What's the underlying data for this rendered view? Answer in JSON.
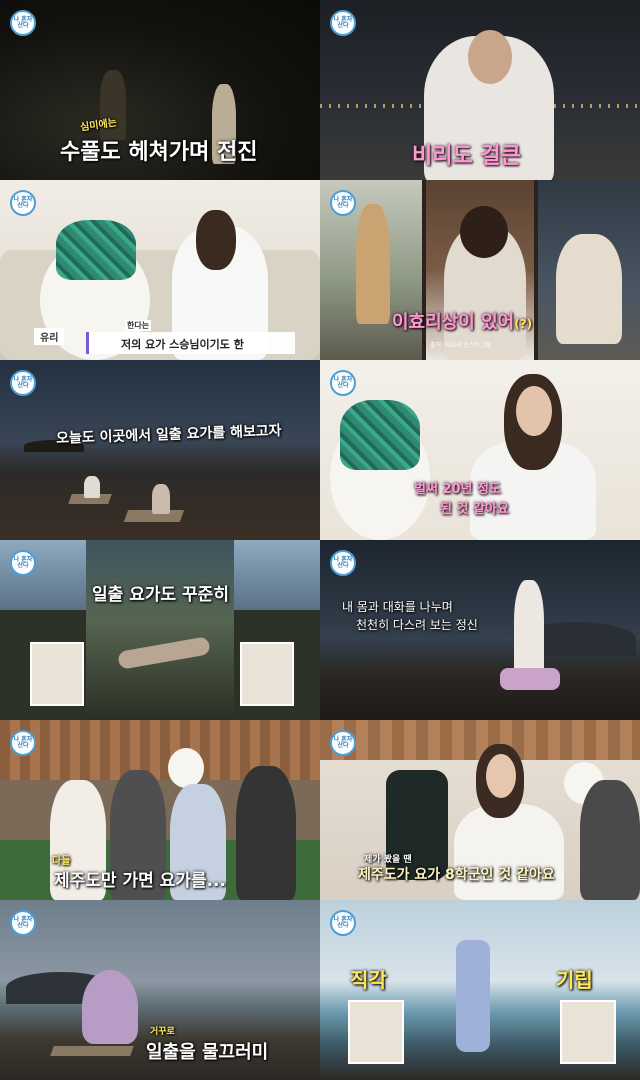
{
  "logo": {
    "label": "나 혼자 산다"
  },
  "panels": {
    "p1": {
      "caption_prefix": "심미에는",
      "caption_main": "수풀도 헤쳐가며 전진"
    },
    "p2": {
      "caption": "비리도 걸큰"
    },
    "p3": {
      "name_tag": "유리",
      "subtitle_label": "한다는",
      "subtitle": "저의 요가 스승님이기도 한"
    },
    "p4": {
      "caption": "이효리상이 있어",
      "caption_suffix": "(?)",
      "credit": "출처: 이효리 인스타그램"
    },
    "p5": {
      "caption": "오늘도 이곳에서 일출 요가를 해보고자"
    },
    "p6": {
      "caption_line1": "벌써 20년 정도",
      "caption_line2": "된 것 같아요"
    },
    "p7": {
      "caption": "일출 요가도 꾸준히"
    },
    "p8": {
      "line1": "내 몸과 대화를 나누며",
      "line2": "천천히 다스려 보는 정신"
    },
    "p9": {
      "caption_prefix": "다들",
      "caption_main": "제주도만 가면 요가를..."
    },
    "p10": {
      "caption_small": "제가 봤을 땐",
      "caption_main": "제주도가 요가 8학군인 것 같아요"
    },
    "p11": {
      "caption_small": "거꾸로",
      "caption_main": "일출을 물끄러미"
    },
    "p12": {
      "left_label": "직각",
      "right_label": "기립"
    }
  }
}
